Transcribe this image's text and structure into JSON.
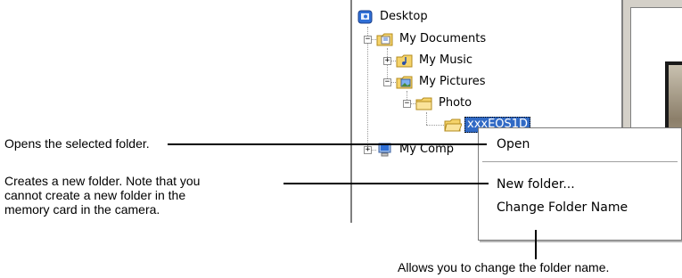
{
  "tree": {
    "items": [
      {
        "label": "Desktop",
        "icon": "desktop-icon"
      },
      {
        "label": "My Documents",
        "icon": "documents-folder-icon",
        "expander": "−"
      },
      {
        "label": "My Music",
        "icon": "music-folder-icon",
        "expander": "+"
      },
      {
        "label": "My Pictures",
        "icon": "pictures-folder-icon",
        "expander": "−"
      },
      {
        "label": "Photo",
        "icon": "folder-icon",
        "expander": "−"
      },
      {
        "label": "xxxEOS1D",
        "icon": "folder-icon",
        "selected": true
      },
      {
        "label": "My Comp",
        "icon": "my-computer-icon",
        "expander": "+"
      }
    ]
  },
  "context_menu": {
    "items": [
      {
        "label": "Open"
      },
      {
        "label": "New folder..."
      },
      {
        "label": "Change Folder Name"
      }
    ]
  },
  "annotations": {
    "open": "Opens the selected folder.",
    "new_folder_line1": "Creates a new folder. Note that you",
    "new_folder_line2": "cannot create a new folder in the",
    "new_folder_line3": "memory card in the camera.",
    "change_name": "Allows you to change the folder name."
  },
  "colors": {
    "selection": "#316ac5",
    "folder": "#f5d36a",
    "pane_gray": "#d4d0c8"
  }
}
